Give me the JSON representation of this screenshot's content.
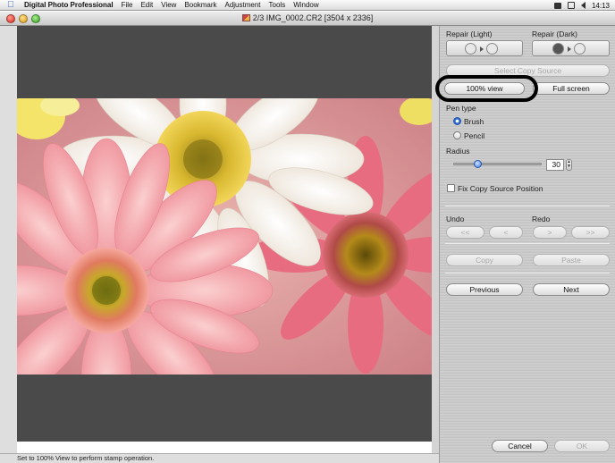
{
  "menubar": {
    "app_name": "Digital Photo Professional",
    "items": [
      "File",
      "Edit",
      "View",
      "Bookmark",
      "Adjustment",
      "Tools",
      "Window"
    ],
    "clock": "14:13",
    "icons": [
      "apple-icon",
      "display-icon",
      "bluetooth-icon",
      "volume-icon"
    ]
  },
  "window": {
    "title": "2/3 IMG_0002.CR2 [3504 x 2336]"
  },
  "panel": {
    "repair_light_label": "Repair (Light)",
    "repair_dark_label": "Repair (Dark)",
    "select_copy_source_label": "Select Copy Source",
    "view_100_label": "100% view",
    "full_screen_label": "Full screen",
    "pen_type_label": "Pen type",
    "brush_label": "Brush",
    "pencil_label": "Pencil",
    "pen_type_selected": "Brush",
    "radius_label": "Radius",
    "radius_value": "30",
    "radius_fraction": 0.27,
    "fix_copy_source_label": "Fix Copy Source Position",
    "fix_copy_source_checked": false,
    "undo_label": "Undo",
    "redo_label": "Redo",
    "undo_all_label": "<<",
    "undo_one_label": "<",
    "redo_one_label": ">",
    "redo_all_label": ">>",
    "copy_label": "Copy",
    "paste_label": "Paste",
    "previous_label": "Previous",
    "next_label": "Next",
    "cancel_label": "Cancel",
    "ok_label": "OK"
  },
  "status": {
    "message": "Set to 100% View to perform stamp operation."
  },
  "colors": {
    "viewer_bg": "#4a4a4a",
    "highlight_ring": "#000000",
    "accent_blue": "#3b7be0"
  }
}
